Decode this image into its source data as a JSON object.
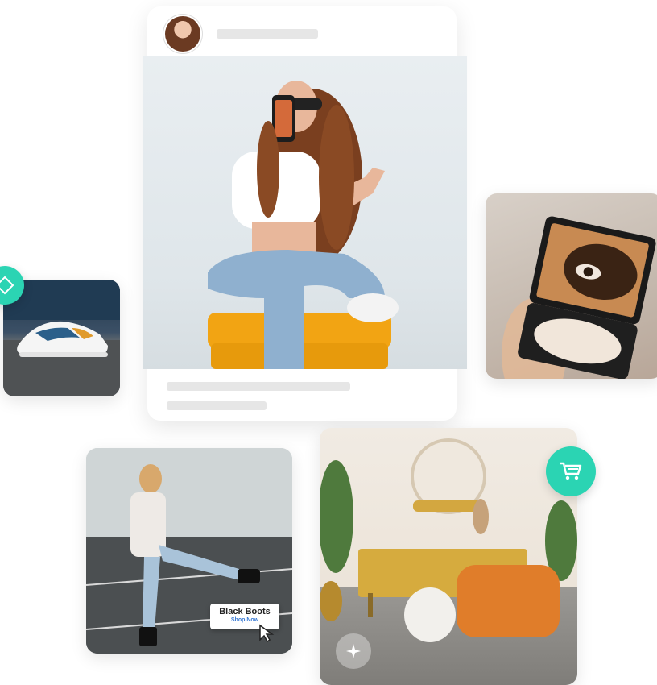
{
  "post": {
    "avatar_alt": "user avatar"
  },
  "boots_tag": {
    "title": "Black Boots",
    "cta": "Shop Now"
  },
  "colors": {
    "accent": "#2bd4b3",
    "placeholder": "#e6e6e6"
  },
  "icons": [
    "tag-icon",
    "shopping-cart-icon",
    "sparkle-icon",
    "cursor-icon"
  ]
}
